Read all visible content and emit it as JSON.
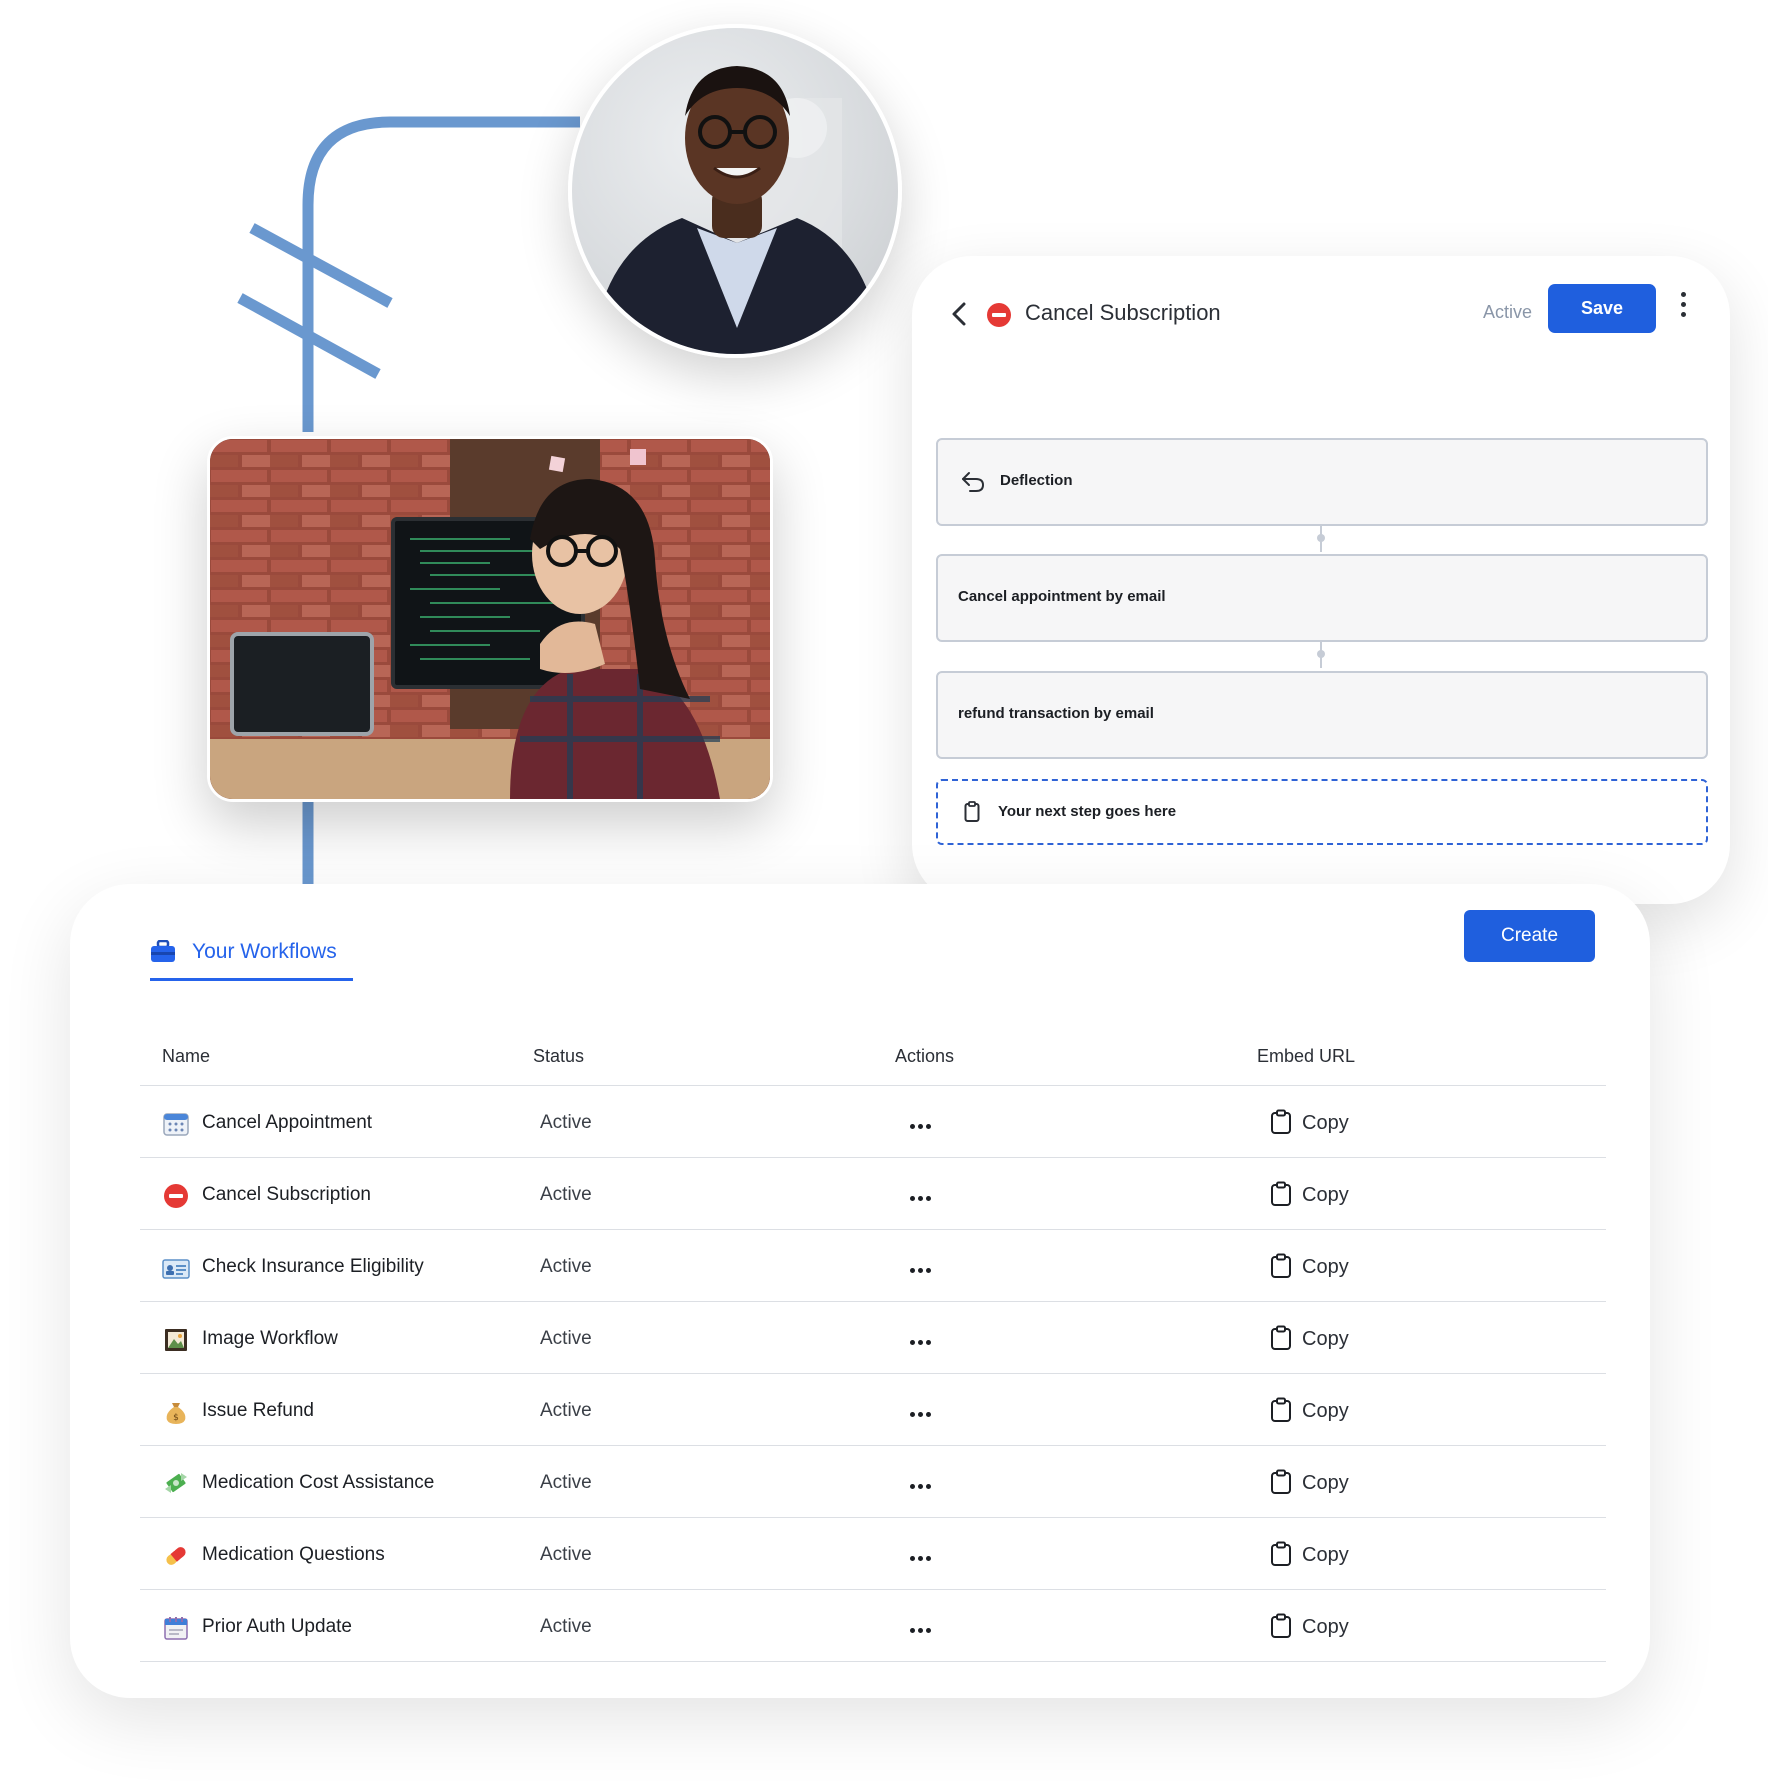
{
  "editor": {
    "title": "Cancel Subscription",
    "status": "Active",
    "save_label": "Save",
    "steps": [
      {
        "label": "Deflection",
        "icon": "undo-arrow-icon"
      },
      {
        "label": "Cancel appointment by email"
      },
      {
        "label": "refund transaction by email"
      }
    ],
    "next_step_placeholder": "Your next step goes here"
  },
  "workflows": {
    "tab_label": "Your Workflows",
    "tab_icon": "briefcase-icon",
    "create_label": "Create",
    "columns": [
      "Name",
      "Status",
      "Actions",
      "Embed URL"
    ],
    "rows": [
      {
        "name": "Cancel Appointment",
        "status": "Active",
        "copy": "Copy",
        "icon": "calendar-icon"
      },
      {
        "name": "Cancel Subscription",
        "status": "Active",
        "copy": "Copy",
        "icon": "no-entry-icon"
      },
      {
        "name": "Check Insurance Eligibility",
        "status": "Active",
        "copy": "Copy",
        "icon": "id-card-icon"
      },
      {
        "name": "Image Workflow",
        "status": "Active",
        "copy": "Copy",
        "icon": "framed-picture-icon"
      },
      {
        "name": "Issue Refund",
        "status": "Active",
        "copy": "Copy",
        "icon": "money-bag-icon"
      },
      {
        "name": "Medication Cost Assistance",
        "status": "Active",
        "copy": "Copy",
        "icon": "money-with-wings-icon"
      },
      {
        "name": "Medication Questions",
        "status": "Active",
        "copy": "Copy",
        "icon": "pill-icon"
      },
      {
        "name": "Prior Auth Update",
        "status": "Active",
        "copy": "Copy",
        "icon": "calendar-spiral-icon"
      }
    ]
  },
  "colors": {
    "accent": "#1f5fde",
    "tab_accent": "#2563eb",
    "connector": "#6a98cf",
    "stop_red": "#e53935"
  }
}
